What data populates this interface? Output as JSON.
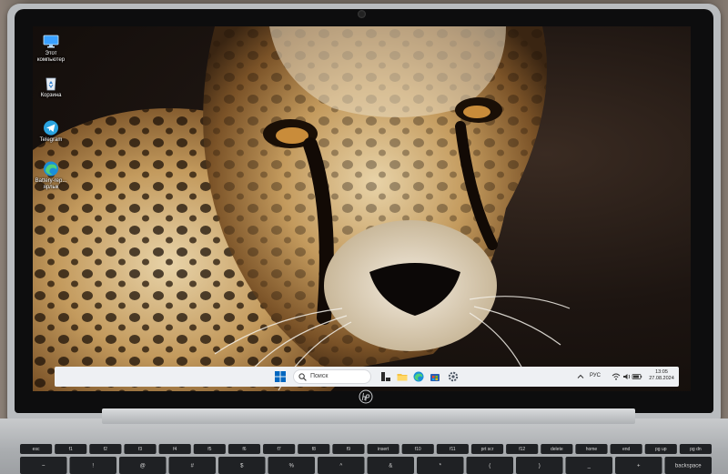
{
  "desktop": {
    "icons": [
      {
        "label": "Этот компьютер",
        "icon": "monitor-icon"
      },
      {
        "label": "Корзина",
        "icon": "recycle-bin-icon"
      },
      {
        "label": "Telegram",
        "icon": "telegram-icon"
      },
      {
        "label": "Battery-rep... ярлык",
        "icon": "edge-icon"
      }
    ]
  },
  "taskbar": {
    "search_placeholder": "Поиск",
    "language": "РУС",
    "clock_time": "13:05",
    "clock_date": "27.08.2024",
    "apps": [
      "widgets-icon",
      "file-explorer-icon",
      "edge-icon",
      "store-icon",
      "settings-icon"
    ]
  },
  "keyboard": {
    "top_row": [
      "esc",
      "f1",
      "f2",
      "f3",
      "f4",
      "f5",
      "f6",
      "f7",
      "f8",
      "f9",
      "insert",
      "f10",
      "f11",
      "prt scr",
      "f12",
      "delete",
      "home",
      "end",
      "pg up",
      "pg dn"
    ],
    "number_row": [
      "~",
      "!",
      "@",
      "#",
      "$",
      "%",
      "^",
      "&",
      "*",
      "(",
      ")",
      "_",
      "+",
      "backspace"
    ]
  },
  "colors": {
    "accent": "#0067c0",
    "taskbar": "#eef0f3"
  }
}
